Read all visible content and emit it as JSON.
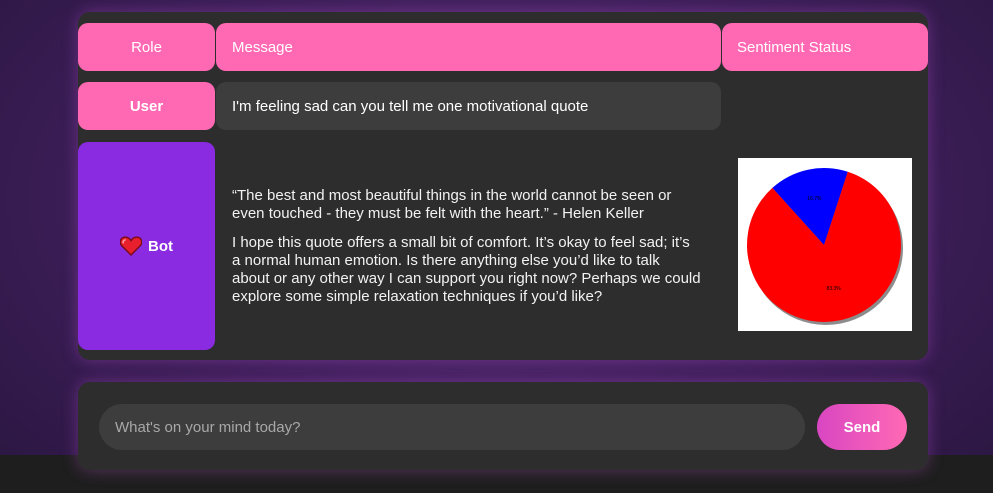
{
  "table": {
    "headers": {
      "role": "Role",
      "message": "Message",
      "sentiment": "Sentiment Status"
    },
    "rows": [
      {
        "role": "User",
        "message": "I'm feeling sad can you tell me one motivational quote"
      },
      {
        "role": "Bot",
        "role_icon": "heart-icon",
        "message_paragraphs": [
          "“The best and most beautiful things in the world cannot be seen or even touched - they must be felt with the heart.” - Helen Keller",
          "I hope this quote offers a small bit of comfort. It’s okay to feel sad; it’s a normal human emotion. Is there anything else you’d like to talk about or any other way I can support you right now? Perhaps we could explore some simple relaxation techniques if you’d like?"
        ]
      }
    ]
  },
  "chart_data": {
    "type": "pie",
    "slices": [
      {
        "value": 16.7,
        "label": "16.7%",
        "color": "#0000ff"
      },
      {
        "value": 83.3,
        "label": "83.3%",
        "color": "#ff0000"
      }
    ]
  },
  "input": {
    "placeholder": "What's on your mind today?",
    "send_label": "Send"
  },
  "colors": {
    "accent_pink": "#ff69b4",
    "bot_purple": "#8a2be2",
    "panel": "#2d2d2d"
  }
}
